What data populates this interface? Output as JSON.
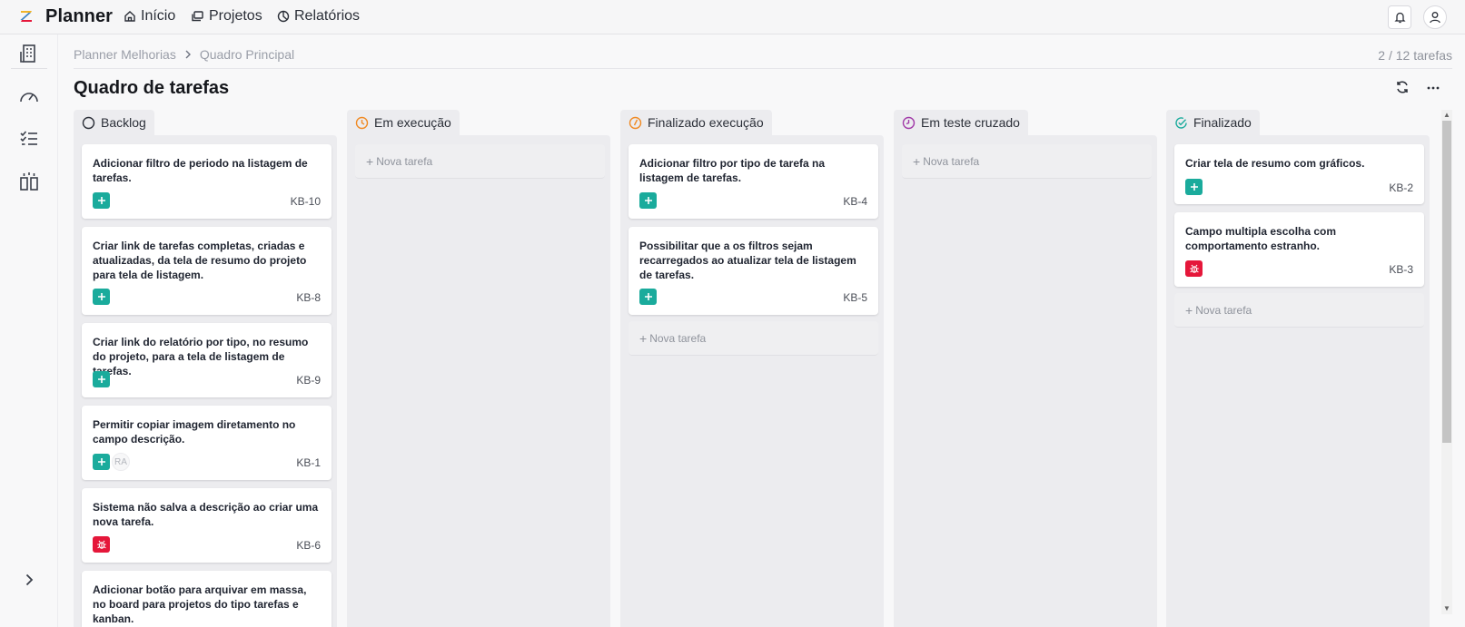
{
  "app": {
    "brand": "Planner",
    "nav": [
      {
        "label": "Início",
        "icon": "home-icon"
      },
      {
        "label": "Projetos",
        "icon": "folders-icon"
      },
      {
        "label": "Relatórios",
        "icon": "pie-chart-icon"
      }
    ]
  },
  "sidebar": {
    "items": [
      {
        "icon": "building-icon"
      },
      {
        "icon": "gauge-icon"
      },
      {
        "icon": "checklist-icon"
      },
      {
        "icon": "board-icon"
      }
    ],
    "expand_icon": "chevron-right-icon"
  },
  "breadcrumb": {
    "project": "Planner Melhorias",
    "board": "Quadro Principal"
  },
  "task_count": "2 / 12 tarefas",
  "page_title": "Quadro de tarefas",
  "new_task_label": "Nova tarefa",
  "colors": {
    "feature": "#1aab9c",
    "bug": "#e5173a",
    "in_progress": "#f08a24",
    "cross_test": "#a13aa8",
    "done": "#1aab9c"
  },
  "columns": [
    {
      "name": "Backlog",
      "status_icon": "circle-empty-icon",
      "cards": [
        {
          "title": "Adicionar filtro de periodo na listagem de tarefas.",
          "key": "KB-10",
          "type": "feature"
        },
        {
          "title": "Criar link de tarefas completas, criadas e atualizadas, da tela de resumo do projeto para tela de listagem.",
          "key": "KB-8",
          "type": "feature"
        },
        {
          "title": "Criar link do relatório por tipo, no resumo do projeto, para a tela de listagem de tarefas.",
          "key": "KB-9",
          "type": "feature"
        },
        {
          "title": "Permitir copiar imagem diretamento no campo descrição.",
          "key": "KB-1",
          "type": "feature",
          "assignee": "RA"
        },
        {
          "title": "Sistema não salva a descrição ao criar uma nova tarefa.",
          "key": "KB-6",
          "type": "bug"
        },
        {
          "title": "Adicionar botão para arquivar em massa, no board para projetos do tipo tarefas e kanban.",
          "key": "",
          "type": "feature"
        }
      ]
    },
    {
      "name": "Em execução",
      "status_icon": "clock-icon",
      "cards": []
    },
    {
      "name": "Finalizado execução",
      "status_icon": "clock-done-icon",
      "cards": [
        {
          "title": "Adicionar filtro por tipo de tarefa na listagem de tarefas.",
          "key": "KB-4",
          "type": "feature"
        },
        {
          "title": "Possibilitar que a os filtros sejam recarregados ao atualizar tela de listagem de tarefas.",
          "key": "KB-5",
          "type": "feature"
        }
      ]
    },
    {
      "name": "Em teste cruzado",
      "status_icon": "clock-purple-icon",
      "cards": []
    },
    {
      "name": "Finalizado",
      "status_icon": "check-circle-icon",
      "cards": [
        {
          "title": "Criar tela de resumo com gráficos.",
          "key": "KB-2",
          "type": "feature"
        },
        {
          "title": "Campo multipla escolha com comportamento estranho.",
          "key": "KB-3",
          "type": "bug"
        }
      ]
    }
  ]
}
